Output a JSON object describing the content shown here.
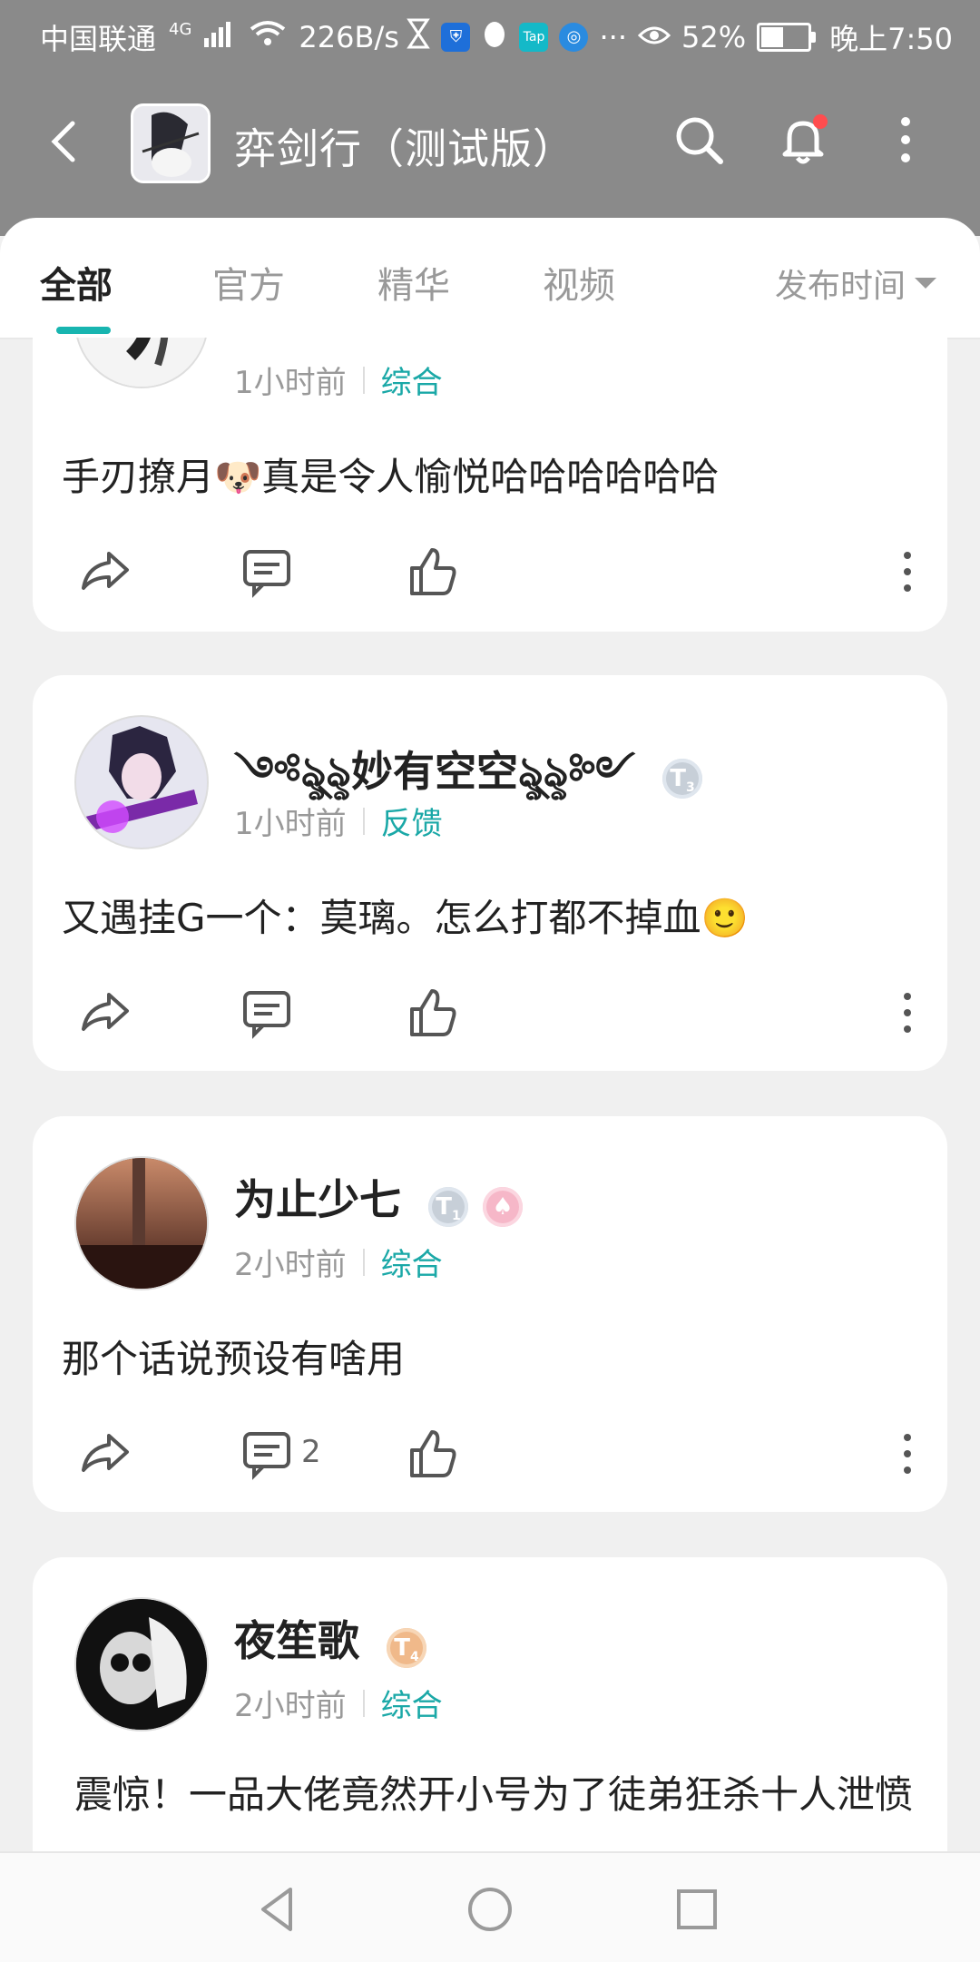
{
  "status_bar": {
    "carrier": "中国联通",
    "network": "4G",
    "speed": "226B/s",
    "battery": "52%",
    "time": "晚上7:50"
  },
  "app_bar": {
    "title": "弈剑行（测试版）",
    "icons": [
      "back-arrow-icon",
      "search-icon",
      "bell-icon",
      "more-vertical-icon"
    ]
  },
  "tabs": {
    "items": [
      "全部",
      "官方",
      "精华",
      "视频"
    ],
    "active": "全部",
    "sort_label": "发布时间",
    "accent_color": "#18b5b0"
  },
  "posts": [
    {
      "time": "1小时前",
      "category": "综合",
      "text": "手刃撩月🐶真是令人愉悦哈哈哈哈哈哈",
      "comment_count": ""
    },
    {
      "username": "༺ৡ্ৡ妙有空空ৡ্ৡ༻",
      "level": "3",
      "time": "1小时前",
      "category": "反馈",
      "text": "又遇挂G一个：莫璃。怎么打都不掉血🙂",
      "comment_count": ""
    },
    {
      "username": "为止少七",
      "level": "1",
      "time": "2小时前",
      "category": "综合",
      "text": "那个话说预设有啥用",
      "comment_count": "2"
    },
    {
      "username": "夜笙歌",
      "level": "4",
      "time": "2小时前",
      "category": "综合",
      "text": "震惊！一品大佬竟然开小号为了徒弟狂杀十人泄愤",
      "comment_count": ""
    }
  ]
}
